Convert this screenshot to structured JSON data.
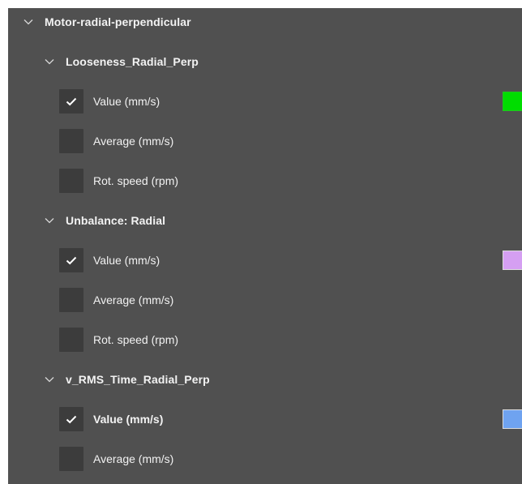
{
  "tree": {
    "group": {
      "label": "Motor-radial-perpendicular",
      "sensors": [
        {
          "label": "Looseness_Radial_Perp",
          "swatch_color": "#00dd00",
          "items": [
            {
              "label": "Value (mm/s)",
              "checked": true
            },
            {
              "label": "Average (mm/s)",
              "checked": false
            },
            {
              "label": "Rot. speed (rpm)",
              "checked": false
            }
          ]
        },
        {
          "label": "Unbalance: Radial",
          "swatch_color": "#d59ff2",
          "items": [
            {
              "label": "Value (mm/s)",
              "checked": true
            },
            {
              "label": "Average (mm/s)",
              "checked": false
            },
            {
              "label": "Rot. speed (rpm)",
              "checked": false
            }
          ]
        },
        {
          "label": "v_RMS_Time_Radial_Perp",
          "swatch_color": "#6fa3f0",
          "items": [
            {
              "label": "Value (mm/s)",
              "checked": true
            },
            {
              "label": "Average (mm/s)",
              "checked": false
            }
          ]
        }
      ]
    }
  },
  "icons": {
    "expand": "chevron-down-icon",
    "check": "check-icon"
  }
}
